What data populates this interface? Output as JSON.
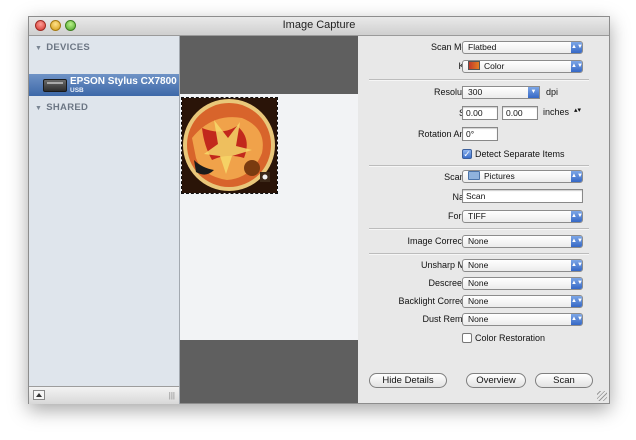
{
  "window": {
    "title": "Image Capture"
  },
  "sidebar": {
    "devices_header": "DEVICES",
    "device": {
      "name": "EPSON Stylus CX7800",
      "connection": "USB"
    },
    "shared_header": "SHARED"
  },
  "scan": {
    "mode_label": "Scan Mode:",
    "mode_value": "Flatbed",
    "kind_label": "Kind:",
    "kind_value": "Color",
    "resolution_label": "Resolution:",
    "resolution_value": "300",
    "resolution_unit": "dpi",
    "size_label": "Size:",
    "width_value": "0.00",
    "height_value": "0.00",
    "size_unit": "inches",
    "rotation_label": "Rotation Angle:",
    "rotation_value": "0°",
    "detect_label": "Detect Separate Items",
    "detect_checked": true,
    "scan_to_label": "Scan To:",
    "scan_to_value": "Pictures",
    "name_label": "Name:",
    "name_value": "Scan",
    "format_label": "Format:",
    "format_value": "TIFF",
    "image_correction_label": "Image Correction:",
    "image_correction_value": "None",
    "unsharp_label": "Unsharp Mask",
    "unsharp_value": "None",
    "descreening_label": "Descreening",
    "descreening_value": "None",
    "backlight_label": "Backlight Correction",
    "backlight_value": "None",
    "dust_label": "Dust Removal",
    "dust_value": "None",
    "color_restoration_label": "Color Restoration",
    "color_restoration_checked": false
  },
  "buttons": {
    "hide_details": "Hide Details",
    "overview": "Overview",
    "scan": "Scan"
  },
  "icons": {
    "popup": "updown-chevron-icon",
    "resolution_popup": "down-arrow-icon",
    "stepper": "stepper-icon"
  },
  "colors": {
    "accent": "#3568c6",
    "selection": "#4a72b0"
  }
}
